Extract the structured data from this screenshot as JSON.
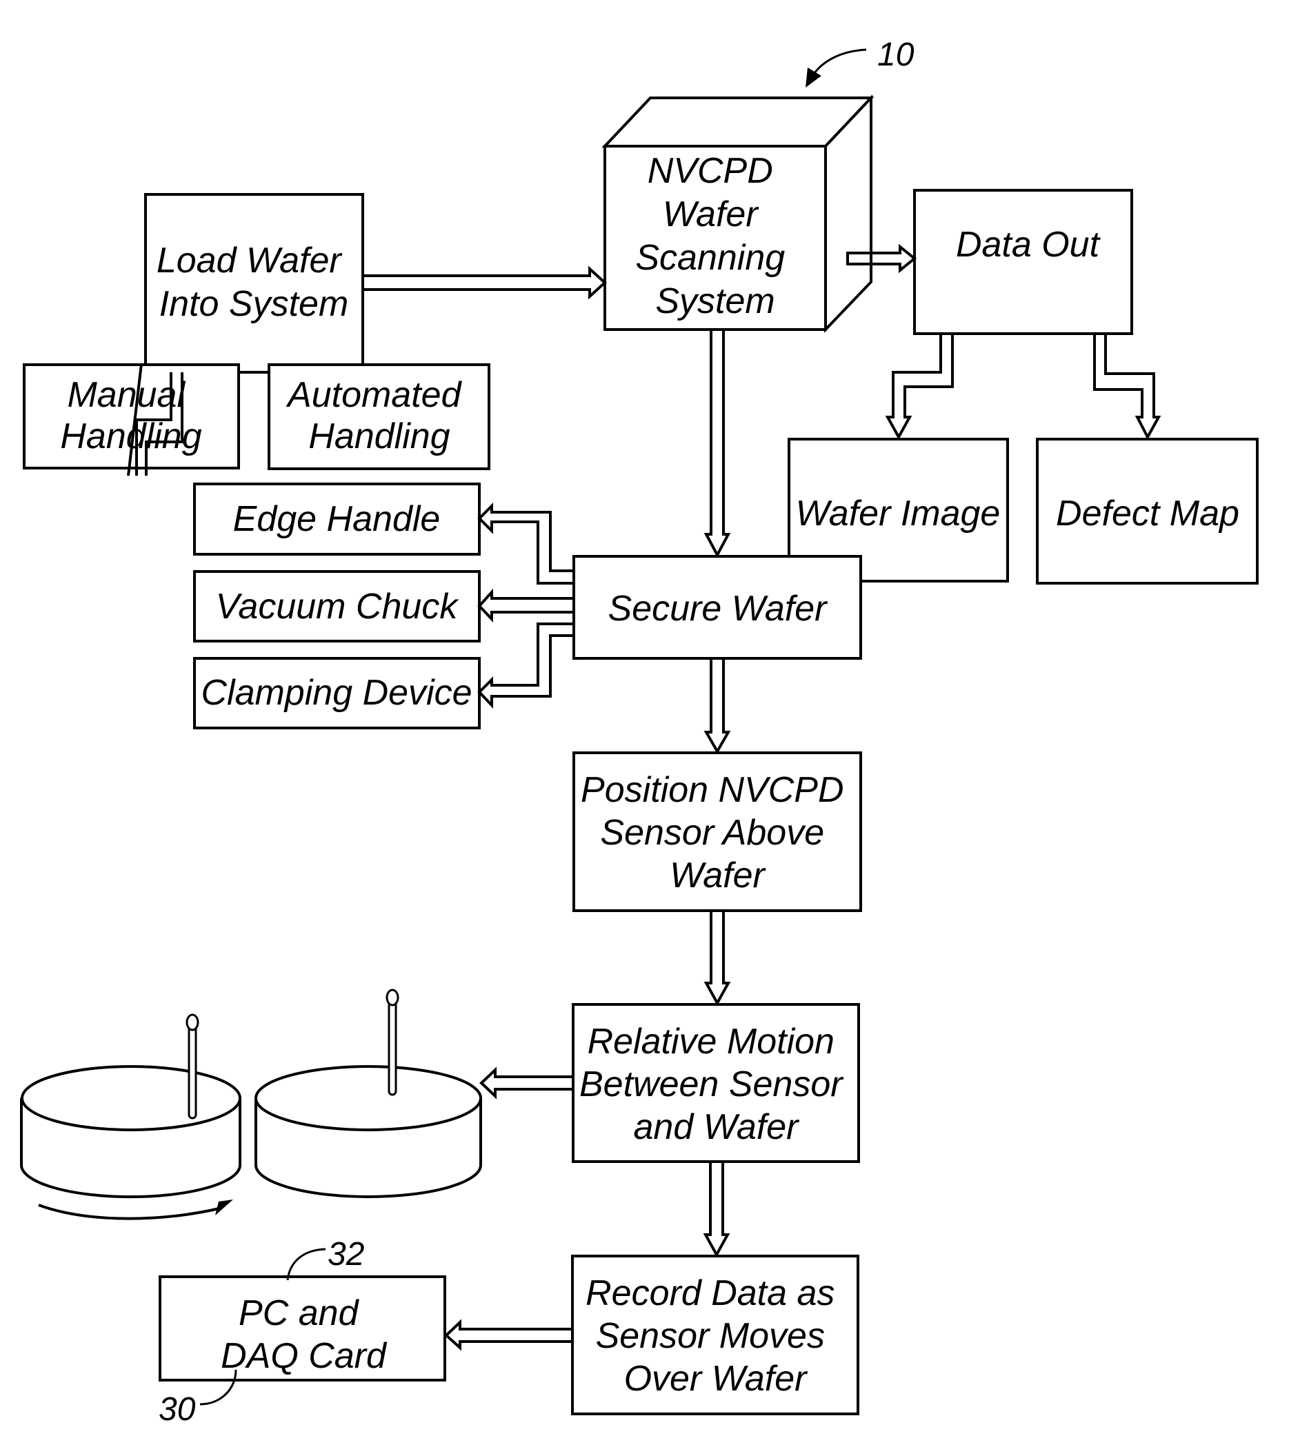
{
  "figure": {
    "reference_numerals": {
      "system": "10",
      "pc_daq": "30",
      "daq_card": "32"
    },
    "colors": {
      "ink": "#000000",
      "paper": "#ffffff"
    },
    "nodes": {
      "scanning_system": {
        "lines": [
          "NVCPD",
          "Wafer",
          "Scanning",
          "System"
        ],
        "shape": "cube"
      },
      "load_wafer": {
        "lines": [
          "Load Wafer",
          "Into System"
        ]
      },
      "manual_handling": {
        "lines": [
          "Manual",
          "Handling"
        ]
      },
      "automated_handling": {
        "lines": [
          "Automated",
          "Handling"
        ]
      },
      "data_out": {
        "lines": [
          "Data Out"
        ]
      },
      "wafer_image": {
        "lines": [
          "Wafer Image"
        ]
      },
      "defect_map": {
        "lines": [
          "Defect Map"
        ]
      },
      "edge_handle": {
        "lines": [
          "Edge Handle"
        ]
      },
      "vacuum_chuck": {
        "lines": [
          "Vacuum Chuck"
        ]
      },
      "clamping_device": {
        "lines": [
          "Clamping Device"
        ]
      },
      "secure_wafer": {
        "lines": [
          "Secure Wafer"
        ]
      },
      "position_sensor": {
        "lines": [
          "Position NVCPD",
          "Sensor Above",
          "Wafer"
        ]
      },
      "relative_motion": {
        "lines": [
          "Relative Motion",
          "Between Sensor",
          "and Wafer"
        ]
      },
      "record_data": {
        "lines": [
          "Record Data as",
          "Sensor Moves",
          "Over Wafer"
        ]
      },
      "pc_daq": {
        "lines": [
          "PC and",
          "DAQ Card"
        ]
      }
    },
    "edges": [
      {
        "from": "load_wafer",
        "to": "scanning_system"
      },
      {
        "from": "load_wafer",
        "to": "manual_handling"
      },
      {
        "from": "load_wafer",
        "to": "automated_handling"
      },
      {
        "from": "scanning_system",
        "to": "data_out"
      },
      {
        "from": "data_out",
        "to": "wafer_image"
      },
      {
        "from": "data_out",
        "to": "defect_map"
      },
      {
        "from": "scanning_system",
        "to": "secure_wafer"
      },
      {
        "from": "secure_wafer",
        "to": "edge_handle"
      },
      {
        "from": "secure_wafer",
        "to": "vacuum_chuck"
      },
      {
        "from": "secure_wafer",
        "to": "clamping_device"
      },
      {
        "from": "secure_wafer",
        "to": "position_sensor"
      },
      {
        "from": "position_sensor",
        "to": "relative_motion"
      },
      {
        "from": "relative_motion",
        "to": "wafer_illustrations"
      },
      {
        "from": "relative_motion",
        "to": "record_data"
      },
      {
        "from": "record_data",
        "to": "pc_daq"
      }
    ],
    "illustrations": [
      {
        "name": "rotating-wafer",
        "description": "wafer with sensor probe, rotation arrow"
      },
      {
        "name": "stationary-wafer",
        "description": "wafer with sensor probe"
      }
    ]
  }
}
